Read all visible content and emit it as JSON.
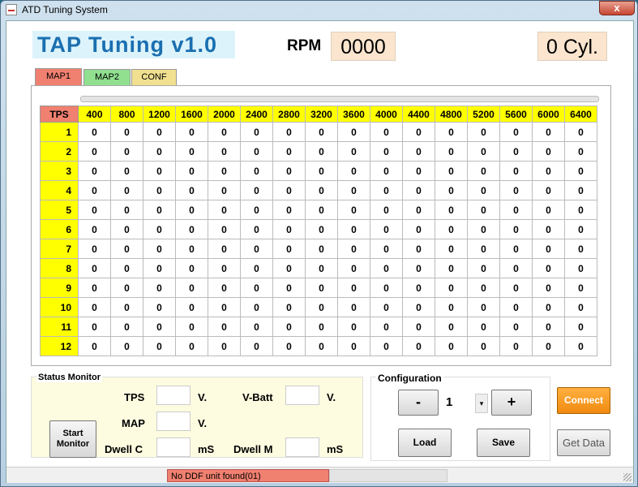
{
  "window": {
    "title": "ATD Tuning System",
    "close_label": "x"
  },
  "header": {
    "app_title": "TAP Tuning v1.0",
    "rpm_label": "RPM",
    "rpm_value": "0000",
    "cyl_value": "0 Cyl."
  },
  "tabs": [
    {
      "label": "MAP1"
    },
    {
      "label": "MAP2"
    },
    {
      "label": "CONF"
    }
  ],
  "table": {
    "corner": "TPS",
    "columns": [
      "400",
      "800",
      "1200",
      "1600",
      "2000",
      "2400",
      "2800",
      "3200",
      "3600",
      "4000",
      "4400",
      "4800",
      "5200",
      "5600",
      "6000",
      "6400"
    ],
    "rows": [
      {
        "tps": "1",
        "cells": [
          "0",
          "0",
          "0",
          "0",
          "0",
          "0",
          "0",
          "0",
          "0",
          "0",
          "0",
          "0",
          "0",
          "0",
          "0",
          "0"
        ]
      },
      {
        "tps": "2",
        "cells": [
          "0",
          "0",
          "0",
          "0",
          "0",
          "0",
          "0",
          "0",
          "0",
          "0",
          "0",
          "0",
          "0",
          "0",
          "0",
          "0"
        ]
      },
      {
        "tps": "3",
        "cells": [
          "0",
          "0",
          "0",
          "0",
          "0",
          "0",
          "0",
          "0",
          "0",
          "0",
          "0",
          "0",
          "0",
          "0",
          "0",
          "0"
        ]
      },
      {
        "tps": "4",
        "cells": [
          "0",
          "0",
          "0",
          "0",
          "0",
          "0",
          "0",
          "0",
          "0",
          "0",
          "0",
          "0",
          "0",
          "0",
          "0",
          "0"
        ]
      },
      {
        "tps": "5",
        "cells": [
          "0",
          "0",
          "0",
          "0",
          "0",
          "0",
          "0",
          "0",
          "0",
          "0",
          "0",
          "0",
          "0",
          "0",
          "0",
          "0"
        ]
      },
      {
        "tps": "6",
        "cells": [
          "0",
          "0",
          "0",
          "0",
          "0",
          "0",
          "0",
          "0",
          "0",
          "0",
          "0",
          "0",
          "0",
          "0",
          "0",
          "0"
        ]
      },
      {
        "tps": "7",
        "cells": [
          "0",
          "0",
          "0",
          "0",
          "0",
          "0",
          "0",
          "0",
          "0",
          "0",
          "0",
          "0",
          "0",
          "0",
          "0",
          "0"
        ]
      },
      {
        "tps": "8",
        "cells": [
          "0",
          "0",
          "0",
          "0",
          "0",
          "0",
          "0",
          "0",
          "0",
          "0",
          "0",
          "0",
          "0",
          "0",
          "0",
          "0"
        ]
      },
      {
        "tps": "9",
        "cells": [
          "0",
          "0",
          "0",
          "0",
          "0",
          "0",
          "0",
          "0",
          "0",
          "0",
          "0",
          "0",
          "0",
          "0",
          "0",
          "0"
        ]
      },
      {
        "tps": "10",
        "cells": [
          "0",
          "0",
          "0",
          "0",
          "0",
          "0",
          "0",
          "0",
          "0",
          "0",
          "0",
          "0",
          "0",
          "0",
          "0",
          "0"
        ]
      },
      {
        "tps": "11",
        "cells": [
          "0",
          "0",
          "0",
          "0",
          "0",
          "0",
          "0",
          "0",
          "0",
          "0",
          "0",
          "0",
          "0",
          "0",
          "0",
          "0"
        ]
      },
      {
        "tps": "12",
        "cells": [
          "0",
          "0",
          "0",
          "0",
          "0",
          "0",
          "0",
          "0",
          "0",
          "0",
          "0",
          "0",
          "0",
          "0",
          "0",
          "0"
        ]
      }
    ]
  },
  "status_monitor": {
    "title": "Status Monitor",
    "tps_label": "TPS",
    "tps_unit": "V.",
    "map_label": "MAP",
    "map_unit": "V.",
    "dwellc_label": "Dwell C",
    "dwellc_unit": "mS",
    "vbatt_label": "V-Batt",
    "vbatt_unit": "V.",
    "dwellm_label": "Dwell M",
    "dwellm_unit": "mS",
    "start_line1": "Start",
    "start_line2": "Monitor"
  },
  "configuration": {
    "title": "Configuration",
    "minus": "-",
    "value": "1",
    "plus": "+",
    "load": "Load",
    "save": "Save"
  },
  "actions": {
    "connect": "Connect",
    "get_data": "Get Data"
  },
  "statusbar": {
    "message": "No DDF unit found(01)"
  },
  "colors": {
    "accent_red": "#f08070",
    "accent_yellow": "#ffff00",
    "connect_orange": "#f08a10"
  }
}
